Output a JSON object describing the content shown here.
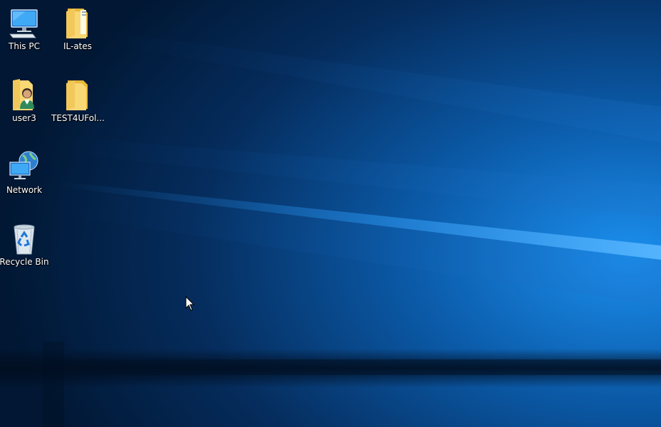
{
  "desktop": {
    "icons": [
      {
        "label": "This PC",
        "icon": "computer-icon"
      },
      {
        "label": "IL-ates",
        "icon": "folder-icon"
      },
      {
        "label": "user3",
        "icon": "user-folder-icon"
      },
      {
        "label": "TEST4UFol...",
        "icon": "folder-icon"
      },
      {
        "label": "Network",
        "icon": "network-icon"
      },
      {
        "label": "Recycle Bin",
        "icon": "recycle-bin-icon"
      }
    ]
  },
  "colors": {
    "wallpaper_dark": "#01193b",
    "wallpaper_mid": "#0a4a8c",
    "wallpaper_light": "#1a8ae8",
    "folder_yellow": "#f8d775",
    "label_text": "#ffffff"
  }
}
